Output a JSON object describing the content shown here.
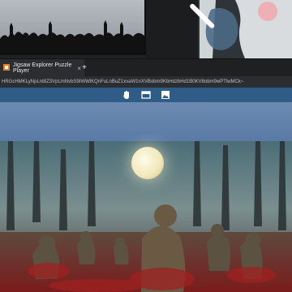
{
  "browser": {
    "tab": {
      "title": "Jigsaw Explorer Puzzle Player",
      "close": "×"
    },
    "new_tab": "+",
    "address": "HRGcHMKLyNpLnt8Z3VpLmNvbS9IWWlKQnFuLnBuZ1xvaW1nXVBobm9KbHdzbHd1B0KV8obm9wPTlwMCk~"
  },
  "puzzle_toolbar": {
    "icons": [
      "hand-icon",
      "box-outline-icon",
      "image-icon"
    ],
    "accent": "#2f5b87"
  }
}
